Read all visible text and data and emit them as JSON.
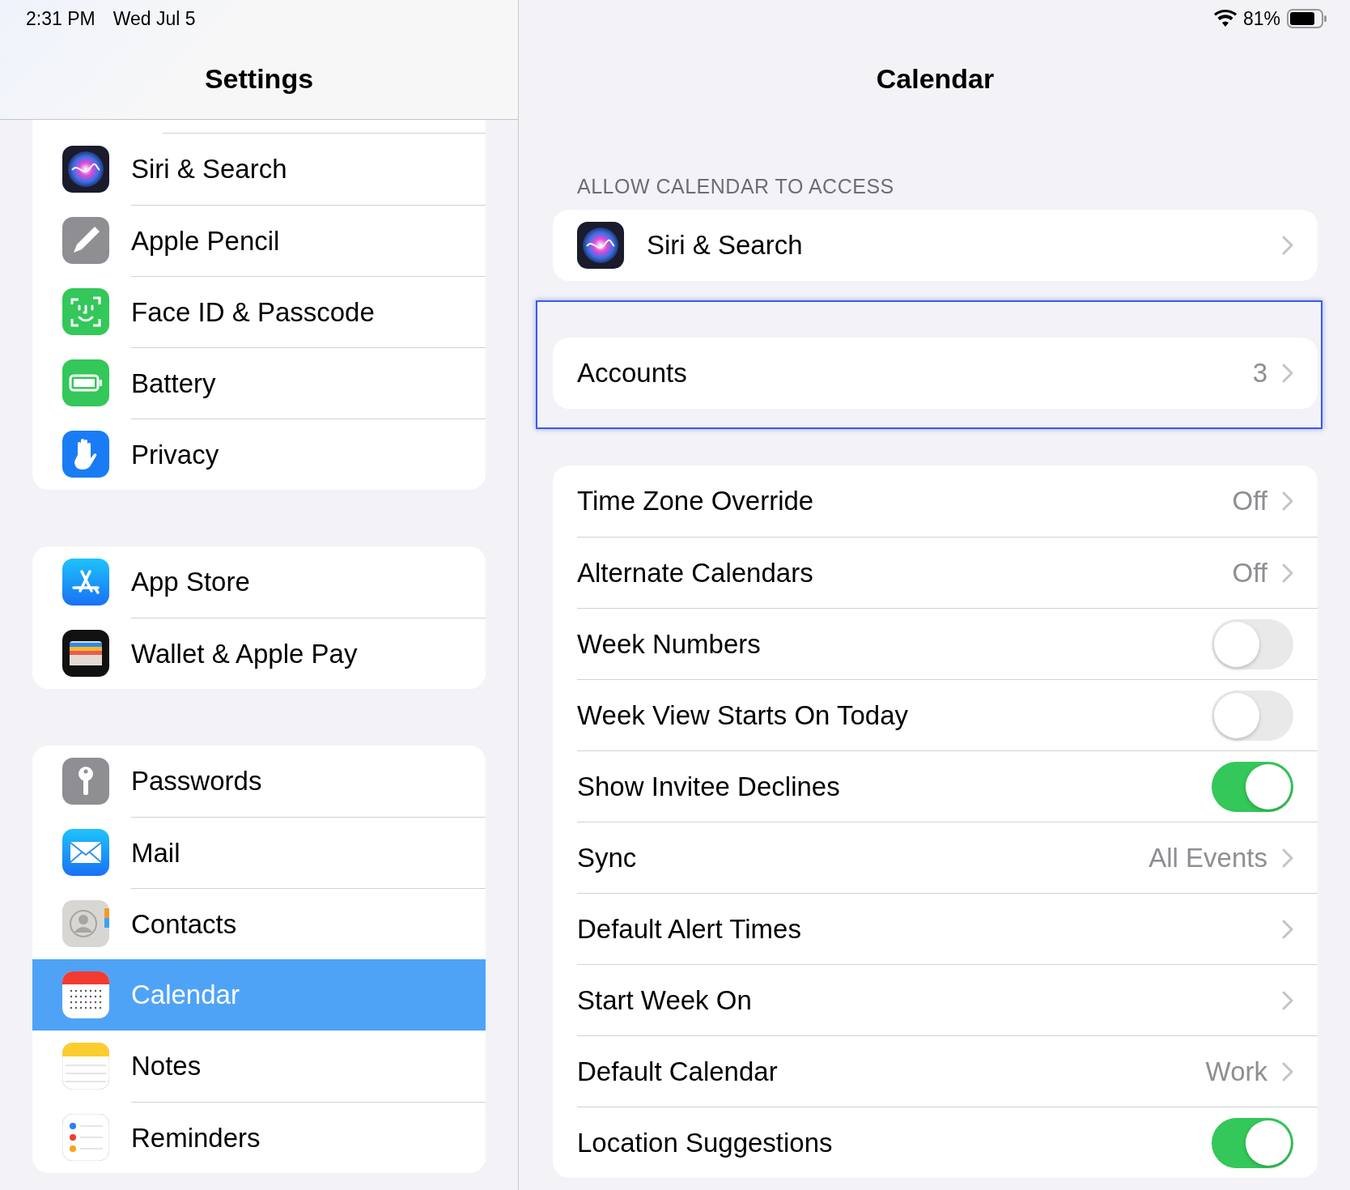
{
  "status_bar": {
    "time": "2:31 PM",
    "date": "Wed Jul 5",
    "battery": "81%"
  },
  "sidebar": {
    "title": "Settings",
    "groups": [
      {
        "items": [
          {
            "label": "Siri & Search",
            "kind": "siri",
            "selected": false
          },
          {
            "label": "Apple Pencil",
            "kind": "pencil",
            "selected": false
          },
          {
            "label": "Face ID & Passcode",
            "kind": "faceid",
            "selected": false
          },
          {
            "label": "Battery",
            "kind": "battery",
            "selected": false
          },
          {
            "label": "Privacy",
            "kind": "privacy",
            "selected": false
          }
        ]
      },
      {
        "items": [
          {
            "label": "App Store",
            "kind": "appstore",
            "selected": false
          },
          {
            "label": "Wallet & Apple Pay",
            "kind": "wallet",
            "selected": false
          }
        ]
      },
      {
        "items": [
          {
            "label": "Passwords",
            "kind": "passwords",
            "selected": false
          },
          {
            "label": "Mail",
            "kind": "mail",
            "selected": false
          },
          {
            "label": "Contacts",
            "kind": "contacts",
            "selected": false
          },
          {
            "label": "Calendar",
            "kind": "calendar",
            "selected": true
          },
          {
            "label": "Notes",
            "kind": "notes",
            "selected": false
          },
          {
            "label": "Reminders",
            "kind": "reminders",
            "selected": false
          }
        ]
      }
    ]
  },
  "detail": {
    "title": "Calendar",
    "sections": [
      {
        "header": "ALLOW CALENDAR TO ACCESS",
        "rows": [
          {
            "kind": "siri",
            "label": "Siri & Search"
          }
        ]
      },
      {
        "highlighted": true,
        "rows": [
          {
            "kind": "link",
            "label": "Accounts",
            "value": "3"
          }
        ]
      },
      {
        "rows": [
          {
            "kind": "link",
            "label": "Time Zone Override",
            "value": "Off"
          },
          {
            "kind": "link",
            "label": "Alternate Calendars",
            "value": "Off"
          },
          {
            "kind": "toggle",
            "label": "Week Numbers",
            "on": false
          },
          {
            "kind": "toggle",
            "label": "Week View Starts On Today",
            "on": false
          },
          {
            "kind": "toggle",
            "label": "Show Invitee Declines",
            "on": true
          },
          {
            "kind": "link",
            "label": "Sync",
            "value": "All Events"
          },
          {
            "kind": "link",
            "label": "Default Alert Times"
          },
          {
            "kind": "link",
            "label": "Start Week On"
          },
          {
            "kind": "link",
            "label": "Default Calendar",
            "value": "Work"
          },
          {
            "kind": "toggle",
            "label": "Location Suggestions",
            "on": true
          }
        ]
      }
    ]
  }
}
